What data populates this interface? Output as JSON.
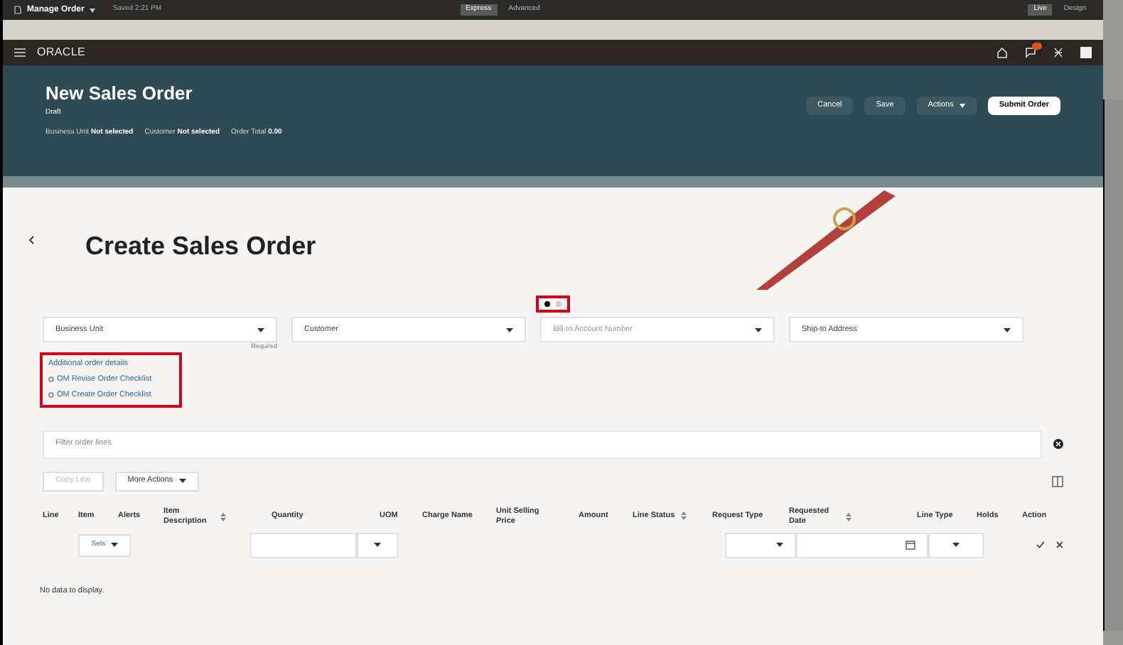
{
  "top_bar": {
    "title": "Manage Order",
    "status": "Saved 2:21 PM",
    "modes": [
      {
        "label": "Express",
        "selected": true
      },
      {
        "label": "Advanced",
        "selected": false
      }
    ],
    "views": [
      {
        "label": "Live",
        "selected": true
      },
      {
        "label": "Design",
        "selected": false
      }
    ]
  },
  "brand": {
    "logo": "ORACLE"
  },
  "header": {
    "title": "New Sales Order",
    "subtitle": "Draft",
    "summary": [
      {
        "label": "Business Unit",
        "value": "Not selected"
      },
      {
        "label": "Customer",
        "value": "Not selected"
      },
      {
        "label": "Order Total",
        "value": "0.00"
      }
    ],
    "buttons": [
      {
        "label": "Cancel",
        "kind": "plain"
      },
      {
        "label": "Save",
        "kind": "plain"
      },
      {
        "label": "Actions",
        "kind": "menu"
      },
      {
        "label": "Submit Order",
        "kind": "primary"
      }
    ]
  },
  "page_title": "Create Sales Order",
  "carousel_dots": [
    {
      "selected": true
    },
    {
      "selected": false
    }
  ],
  "fields": [
    {
      "placeholder": "Business Unit",
      "hint": "Required",
      "disabled": false
    },
    {
      "placeholder": "Customer",
      "disabled": false
    },
    {
      "placeholder": "Bill-to Account Number",
      "disabled": true
    },
    {
      "placeholder": "Ship-to Address",
      "disabled": false
    }
  ],
  "additional_details": {
    "title": "Additional order details",
    "links": [
      "OM Revise Order Checklist",
      "OM Create Order Checklist"
    ]
  },
  "filter": {
    "placeholder": "Filter order lines"
  },
  "toolbar": [
    {
      "label": "Copy Line",
      "disabled": true,
      "kind": "plain"
    },
    {
      "label": "More Actions",
      "disabled": false,
      "kind": "menu"
    }
  ],
  "table": {
    "columns": [
      {
        "label": "Line",
        "sortable": false
      },
      {
        "label": "Item",
        "sortable": false
      },
      {
        "label": "Alerts",
        "sortable": false
      },
      {
        "label": "Item Description",
        "sortable": true
      },
      {
        "label": "Quantity",
        "sortable": false
      },
      {
        "label": "UOM",
        "sortable": false
      },
      {
        "label": "Charge Name",
        "sortable": false
      },
      {
        "label": "Unit Selling Price",
        "sortable": false
      },
      {
        "label": "Amount",
        "sortable": false
      },
      {
        "label": "Line Status",
        "sortable": true
      },
      {
        "label": "Request Type",
        "sortable": false
      },
      {
        "label": "Requested Date",
        "sortable": true
      },
      {
        "label": "Line Type",
        "sortable": false
      },
      {
        "label": "Holds",
        "sortable": false
      },
      {
        "label": "Action",
        "sortable": false
      }
    ],
    "edit_row": {
      "item_type": "Sels"
    },
    "empty_message": "No data to display."
  }
}
